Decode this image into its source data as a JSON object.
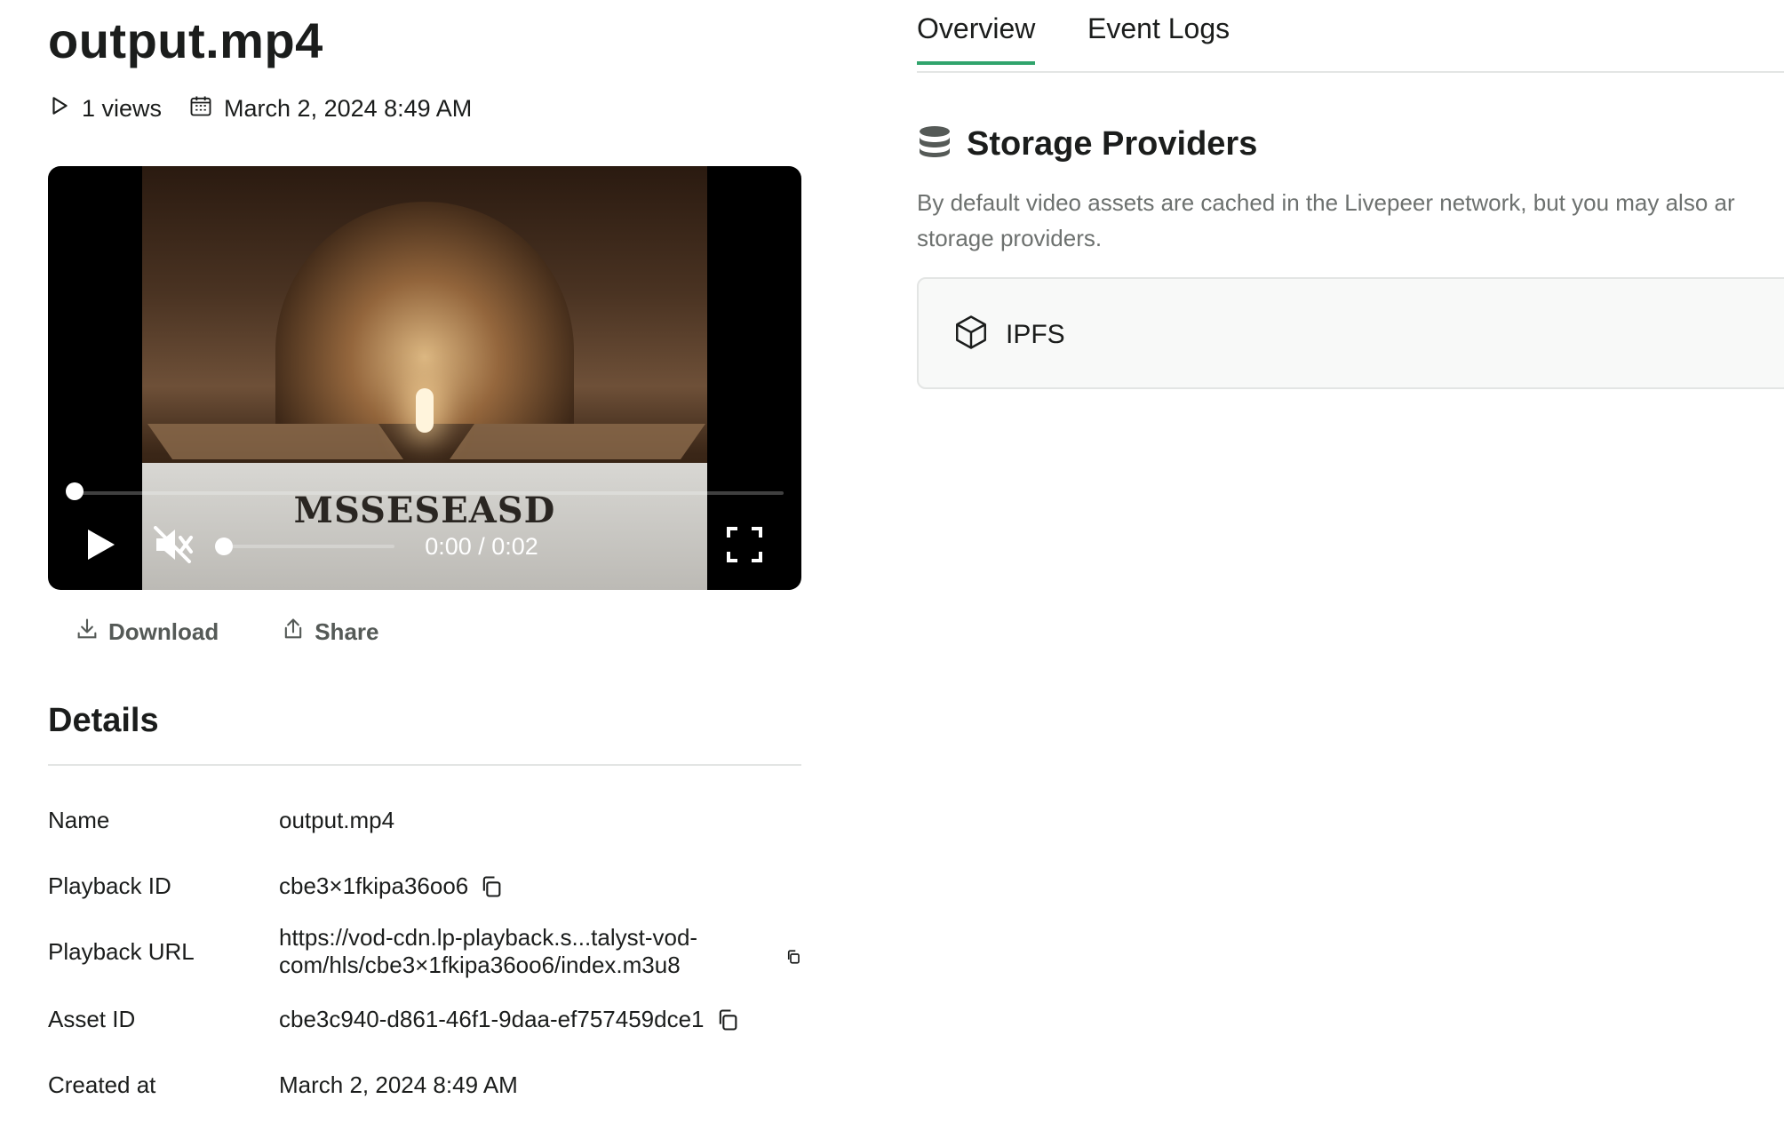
{
  "asset": {
    "title": "output.mp4",
    "views": "1 views",
    "date": "March 2, 2024 8:49 AM"
  },
  "player": {
    "timecode": "0:00 / 0:02",
    "progress": 0,
    "volume": 0,
    "muted": true,
    "frame_text": "MSSESEASD"
  },
  "actions": {
    "download": "Download",
    "share": "Share"
  },
  "details": {
    "heading": "Details",
    "rows": [
      {
        "label": "Name",
        "value": "output.mp4"
      },
      {
        "label": "Playback ID",
        "value": "cbe3×1fkipa36oo6"
      },
      {
        "label": "Playback URL",
        "value_line1": "https://vod-cdn.lp-playback.s...talyst-vod-",
        "value_line2": "com/hls/cbe3×1fkipa36oo6/index.m3u8"
      },
      {
        "label": "Asset ID",
        "value": "cbe3c940-d861-46f1-9daa-ef757459dce1"
      },
      {
        "label": "Created at",
        "value": "March 2, 2024 8:49 AM"
      }
    ]
  },
  "tabs": [
    {
      "label": "Overview",
      "active": true
    },
    {
      "label": "Event Logs",
      "active": false
    }
  ],
  "storage": {
    "heading": "Storage Providers",
    "description_line1": "By default video assets are cached in the Livepeer network, but you may also ar",
    "description_line2": "storage providers.",
    "providers": [
      {
        "name": "IPFS"
      }
    ]
  },
  "colors": {
    "accent": "#30a46c",
    "text": "#1b1d1c",
    "muted_text": "#6d716f"
  },
  "icons": {
    "views": "play-outline-icon",
    "date": "calendar-icon",
    "play": "play-icon",
    "mute": "speaker-muted-icon",
    "fullscreen": "fullscreen-icon",
    "download": "download-icon",
    "share": "share-icon",
    "copy": "copy-icon",
    "storage": "database-icon",
    "provider": "cube-icon"
  }
}
